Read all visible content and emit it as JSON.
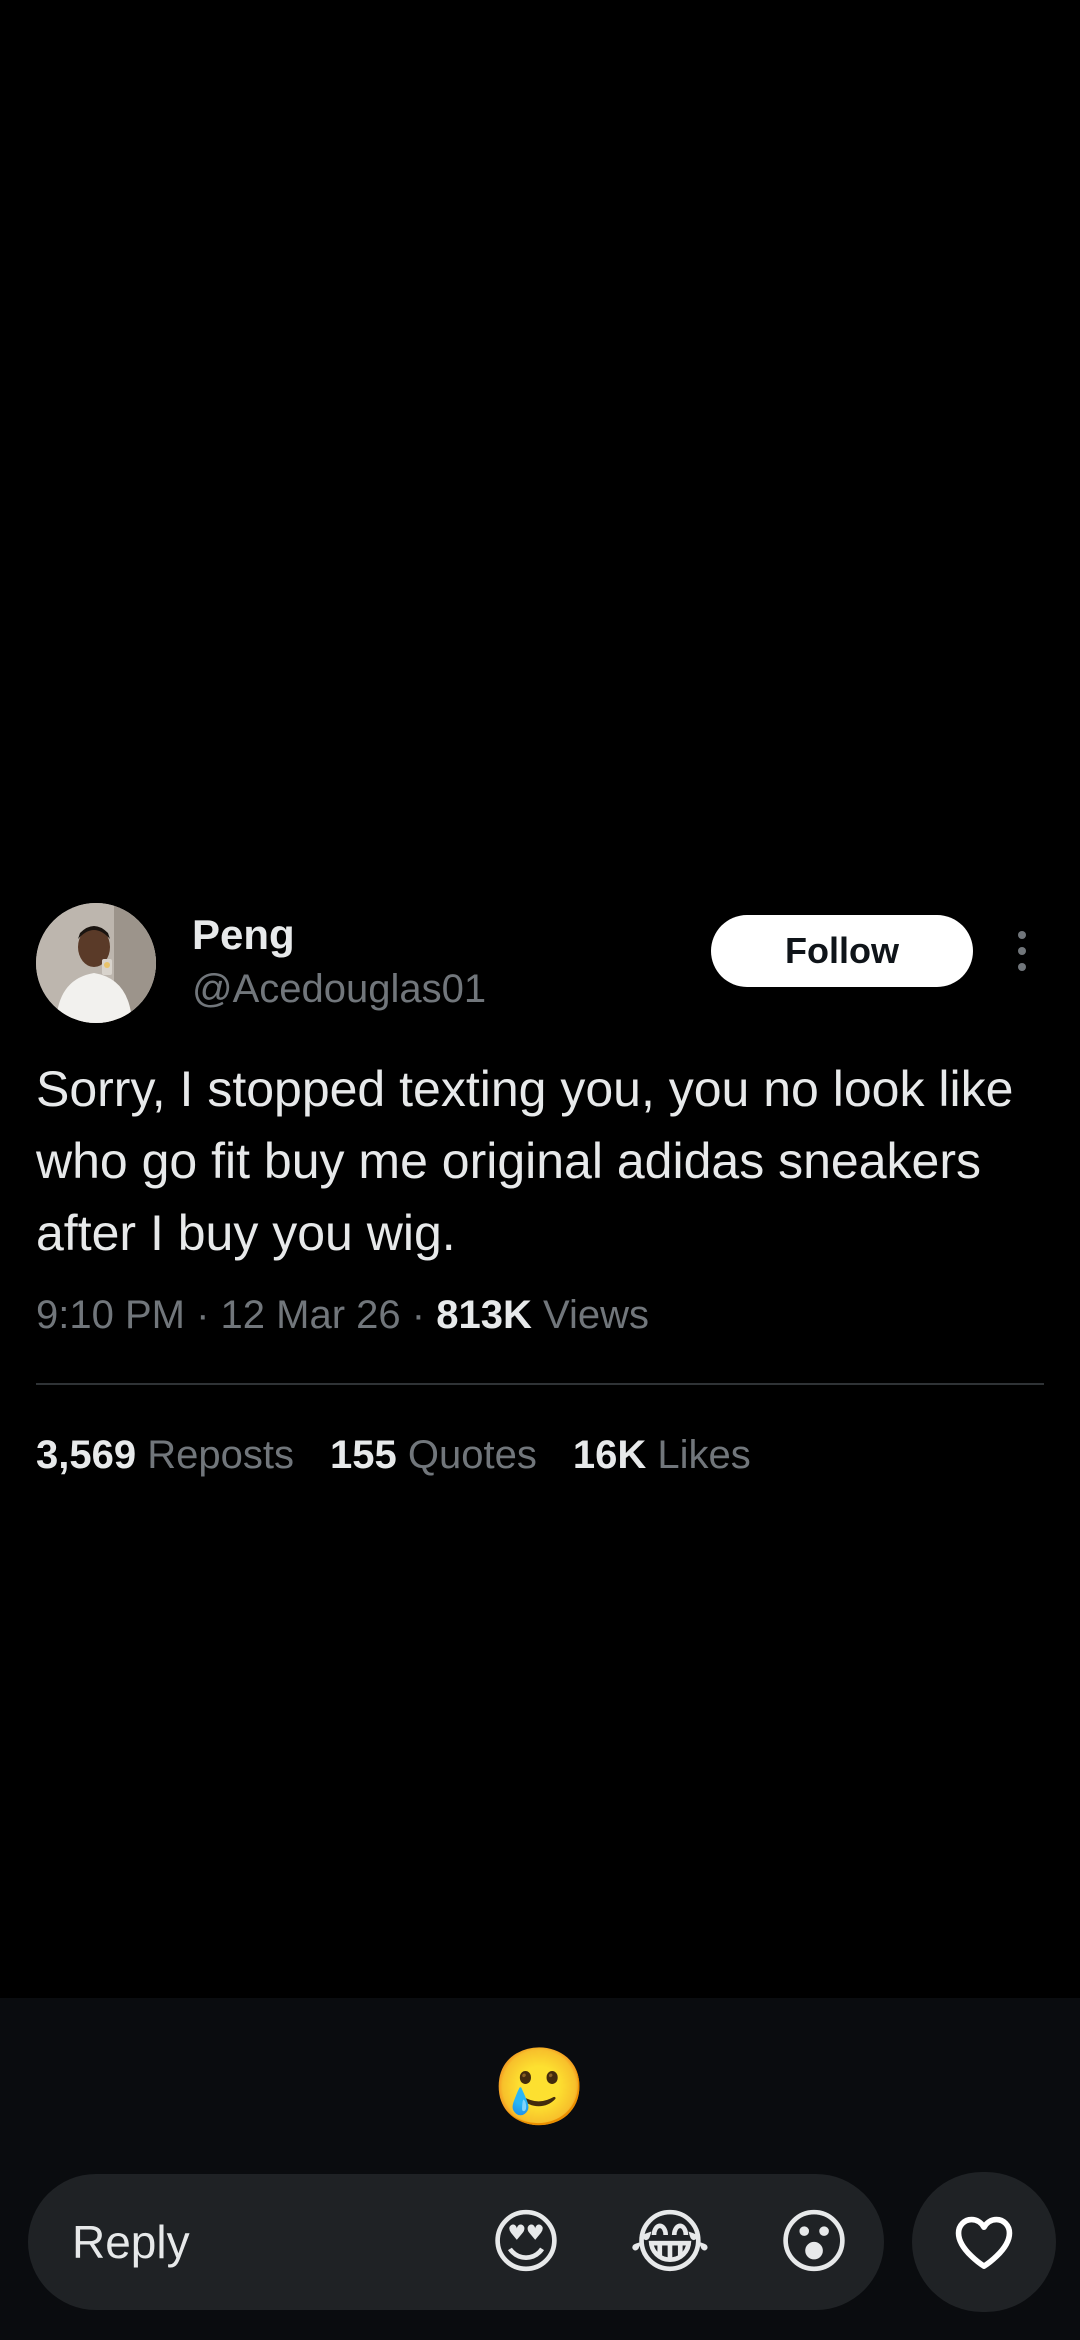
{
  "tweet": {
    "display_name": "Peng",
    "handle": "@Acedouglas01",
    "follow_label": "Follow",
    "text": "Sorry, I stopped texting you, you no look like who go fit buy me original adidas sneakers after I buy you wig.",
    "time": "9:10 PM",
    "separator": "·",
    "date": "12 Mar 26",
    "views_count": "813K",
    "views_label": "Views",
    "stats": [
      {
        "count": "3,569",
        "label": "Reposts"
      },
      {
        "count": "155",
        "label": "Quotes"
      },
      {
        "count": "16K",
        "label": "Likes"
      }
    ]
  },
  "bottom_bar": {
    "selected_reaction": "🥲",
    "reply_label": "Reply",
    "reactions": [
      "😍",
      "😂",
      "😮"
    ]
  },
  "colors": {
    "background": "#000000",
    "text_primary": "#e7e9ea",
    "text_secondary": "#71767b",
    "follow_bg": "#ffffff",
    "panel_bg": "#0a0c0f",
    "pill_bg": "#1f2225"
  },
  "icons": {
    "more": "more-vertical-icon",
    "like": "heart-icon"
  }
}
